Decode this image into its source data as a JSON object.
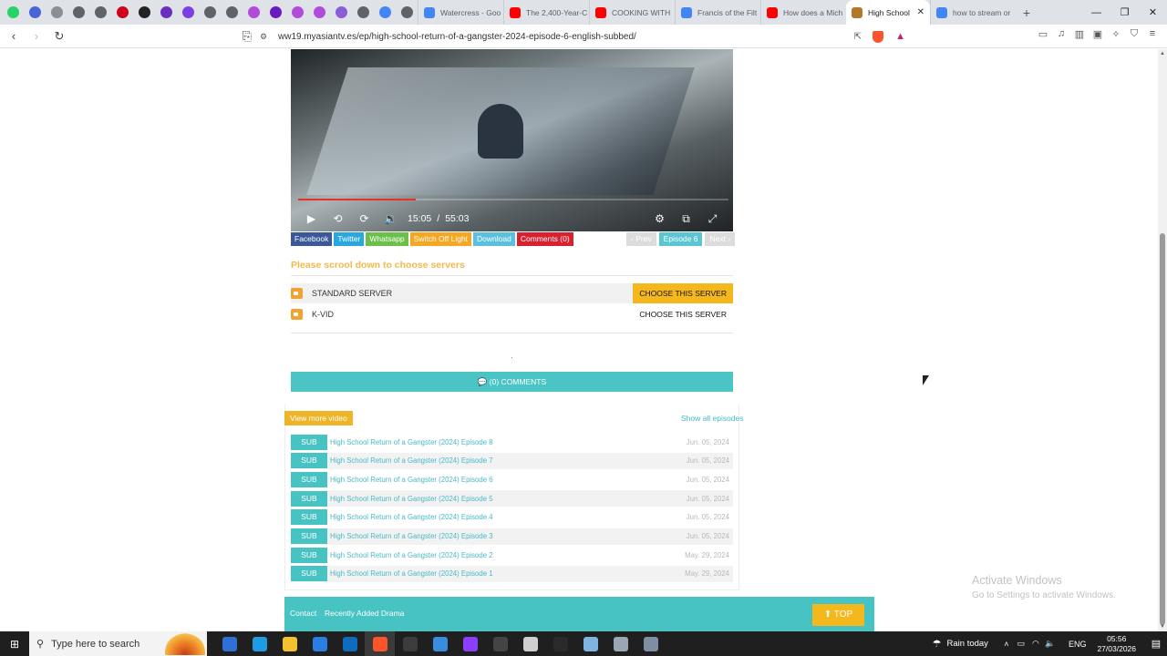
{
  "browser": {
    "pinned_colors": [
      "#25d366",
      "#4a63d8",
      "#8a8f96",
      "#5f6368",
      "#5f6368",
      "#d0021b",
      "#222222",
      "#6b2fbf",
      "#7b3fe4",
      "#5f6368",
      "#5f6368",
      "#b24bd9",
      "#6a1bbf",
      "#b24bd9",
      "#b24bd9",
      "#8a5cd6",
      "#5f6368",
      "#4285f4",
      "#5f6368"
    ],
    "tabs": [
      {
        "label": "Watercress - Goo",
        "color": "#4285f4",
        "active": false
      },
      {
        "label": "The 2,400-Year-C",
        "color": "#ff0000",
        "active": false
      },
      {
        "label": "COOKING WITH",
        "color": "#ff0000",
        "active": false
      },
      {
        "label": "Francis of the Filt",
        "color": "#4285f4",
        "active": false
      },
      {
        "label": "How does a Mich",
        "color": "#ff0000",
        "active": false
      },
      {
        "label": "High School",
        "color": "#b07a2a",
        "active": true
      },
      {
        "label": "how to stream or",
        "color": "#4285f4",
        "active": false
      }
    ],
    "url": "ww19.myasiantv.es/ep/high-school-return-of-a-gangster-2024-episode-6-english-subbed/"
  },
  "player": {
    "current_time": "15:05",
    "separator": "/",
    "duration": "55:03",
    "progress_fraction": 0.274
  },
  "share_buttons": [
    {
      "label": "Facebook",
      "color": "#3b5998"
    },
    {
      "label": "Twitter",
      "color": "#29a8e0"
    },
    {
      "label": "Whatsapp",
      "color": "#6cc04a"
    },
    {
      "label": "Switch Off Light",
      "color": "#f5a623"
    },
    {
      "label": "Download",
      "color": "#5bc0de"
    },
    {
      "label": "Comments (0)",
      "color": "#d9202f"
    }
  ],
  "episode_nav": {
    "prev": "‹ Prev",
    "current": "Episode 6",
    "next": "Next ›"
  },
  "server_notice": "Please scrool down to choose servers",
  "servers": [
    {
      "name": "STANDARD SERVER",
      "choose": "CHOOSE THIS SERVER",
      "selected": true
    },
    {
      "name": "K-VID",
      "choose": "CHOOSE THIS SERVER",
      "selected": false
    }
  ],
  "comments_bar": "💬 (0) COMMENTS",
  "more_video": {
    "view_more": "View more video",
    "show_all": "Show all episodes"
  },
  "episodes": [
    {
      "badge": "SUB",
      "title": "High School Return of a Gangster (2024) Episode 8",
      "date": "Jun. 05, 2024"
    },
    {
      "badge": "SUB",
      "title": "High School Return of a Gangster (2024) Episode 7",
      "date": "Jun. 05, 2024"
    },
    {
      "badge": "SUB",
      "title": "High School Return of a Gangster (2024) Episode 6",
      "date": "Jun. 05, 2024"
    },
    {
      "badge": "SUB",
      "title": "High School Return of a Gangster (2024) Episode 5",
      "date": "Jun. 05, 2024"
    },
    {
      "badge": "SUB",
      "title": "High School Return of a Gangster (2024) Episode 4",
      "date": "Jun. 05, 2024"
    },
    {
      "badge": "SUB",
      "title": "High School Return of a Gangster (2024) Episode 3",
      "date": "Jun. 05, 2024"
    },
    {
      "badge": "SUB",
      "title": "High School Return of a Gangster (2024) Episode 2",
      "date": "May. 29, 2024"
    },
    {
      "badge": "SUB",
      "title": "High School Return of a Gangster (2024) Episode 1",
      "date": "May. 29, 2024"
    }
  ],
  "footer": {
    "contact": "Contact",
    "recent": "Recently Added Drama",
    "top": "⬆ TOP"
  },
  "watermark": {
    "line1": "Activate Windows",
    "line2": "Go to Settings to activate Windows."
  },
  "taskbar": {
    "search_placeholder": "Type here to search",
    "weather": "Rain today",
    "language": "ENG",
    "time": "05:56",
    "date": "27/03/2026",
    "app_colors": [
      "#2f6fd6",
      "#1f9be3",
      "#f2c230",
      "#2a7de1",
      "#0f6cbd",
      "#fb542b",
      "#3c3c3c",
      "#3a8dde",
      "#8a3ffc",
      "#444444",
      "#cfcfcf",
      "#2a2a2a",
      "#7fb3e0",
      "#9aa6b4",
      "#7f8fa3"
    ]
  }
}
